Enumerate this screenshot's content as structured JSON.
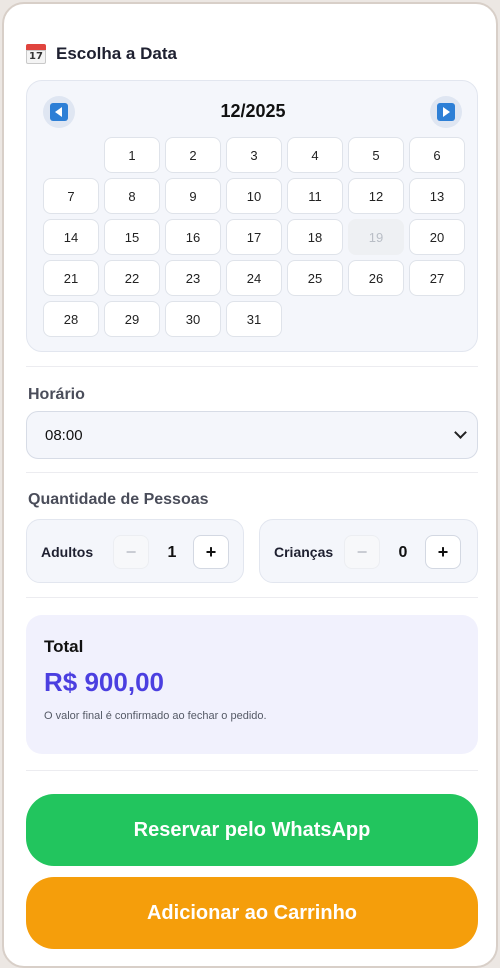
{
  "date_section": {
    "title": "Escolha a Data",
    "icon": "calendar-icon",
    "icon_text": "17",
    "month_label": "12/2025",
    "prev_icon": "arrow-left-icon",
    "next_icon": "arrow-right-icon",
    "leading_blanks": 1,
    "days": [
      "1",
      "2",
      "3",
      "4",
      "5",
      "6",
      "7",
      "8",
      "9",
      "10",
      "11",
      "12",
      "13",
      "14",
      "15",
      "16",
      "17",
      "18",
      "19",
      "20",
      "21",
      "22",
      "23",
      "24",
      "25",
      "26",
      "27",
      "28",
      "29",
      "30",
      "31"
    ],
    "disabled_days": [
      "19"
    ]
  },
  "time_section": {
    "label": "Horário",
    "selected": "08:00"
  },
  "people_section": {
    "label": "Quantidade de Pessoas",
    "adults": {
      "label": "Adultos",
      "value": "1",
      "minus": "−",
      "plus": "+"
    },
    "children": {
      "label": "Crianças",
      "value": "0",
      "minus": "−",
      "plus": "+"
    }
  },
  "total": {
    "label": "Total",
    "value": "R$ 900,00",
    "note": "O valor final é confirmado ao fechar o pedido."
  },
  "actions": {
    "whatsapp_label": "Reservar pelo WhatsApp",
    "cart_label": "Adicionar ao Carrinho"
  },
  "colors": {
    "accent": "#4b3fe0",
    "whatsapp": "#22c55e",
    "cart": "#f59e0b",
    "nav": "#2d7fd6"
  }
}
